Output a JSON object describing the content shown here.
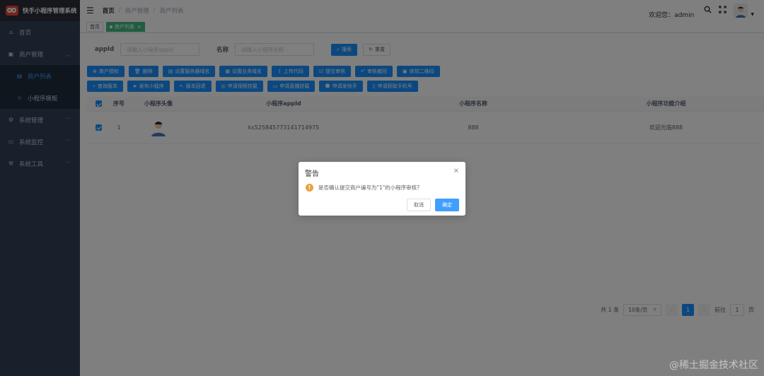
{
  "app": {
    "title": "快手小程序管理系统"
  },
  "sidebar": {
    "items": [
      {
        "label": "首页",
        "icon": "dashboard-icon"
      },
      {
        "label": "商户管理",
        "icon": "shop-icon",
        "expanded": true,
        "children": [
          {
            "label": "商户列表",
            "icon": "list-icon",
            "active": true
          },
          {
            "label": "小程序模板",
            "icon": "star-icon"
          }
        ]
      },
      {
        "label": "系统管理",
        "icon": "gear-icon"
      },
      {
        "label": "系统监控",
        "icon": "monitor-icon"
      },
      {
        "label": "系统工具",
        "icon": "tool-icon"
      }
    ]
  },
  "navbar": {
    "breadcrumb": [
      "首页",
      "商户管理",
      "商户列表"
    ],
    "welcome": "欢迎您：admin"
  },
  "tags": {
    "home": "首页",
    "active": "商户列表"
  },
  "search": {
    "appid_label": "appId",
    "appid_placeholder": "请输入小程序appId",
    "name_label": "名称",
    "name_placeholder": "请输入小程序名称",
    "search_btn": "搜索",
    "reset_btn": "重置"
  },
  "toolbar": {
    "row1": [
      "商户授权",
      "删除",
      "设置服务器域名",
      "设置业务域名",
      "上传代码",
      "提交审核",
      "审核撤回",
      "体验二维码"
    ],
    "row2": [
      "查询版本",
      "发布小程序",
      "版本回退",
      "申请视频挂载",
      "申请直播挂载",
      "申请发快手",
      "申请获取手机号"
    ]
  },
  "table": {
    "headers": [
      "序号",
      "小程序头像",
      "小程序appId",
      "小程序名称",
      "小程序功能介绍"
    ],
    "rows": [
      {
        "index": "1",
        "appid": "ks525845773141714975",
        "name": "888",
        "intro": "欢迎光临888"
      }
    ]
  },
  "pagination": {
    "total": "共 1 条",
    "page_size": "10条/页",
    "current": "1",
    "goto_label": "前往",
    "goto_value": "1",
    "page_suffix": "页"
  },
  "dialog": {
    "title": "警告",
    "message": "是否确认提交商户编号为\"1\"的小程序审核?",
    "cancel": "取消",
    "confirm": "确定"
  },
  "watermark": "@稀土掘金技术社区",
  "colors": {
    "primary": "#1890ff",
    "sidebar": "#304156",
    "tag_active": "#42b983",
    "warning": "#e6a23c"
  }
}
